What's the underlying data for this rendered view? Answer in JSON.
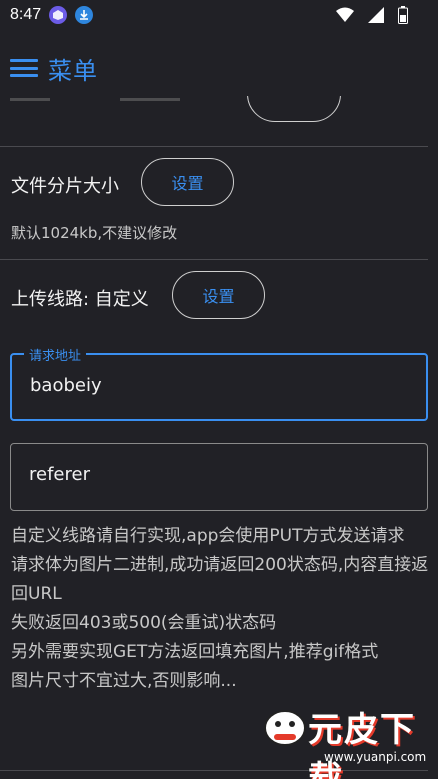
{
  "status_bar": {
    "time": "8:47",
    "icons": [
      "app-badge-icon",
      "download-icon",
      "wifi-icon",
      "signal-icon",
      "battery-icon"
    ]
  },
  "app_bar": {
    "title": "菜单",
    "menu_icon": "hamburger-menu-icon",
    "accent_color": "#3a8ff0"
  },
  "file_chunk": {
    "label": "文件分片大小",
    "button_label": "设置",
    "hint": "默认1024kb,不建议修改"
  },
  "upload_route": {
    "label": "上传线路: 自定义",
    "button_label": "设置"
  },
  "request_url_field": {
    "legend": "请求地址",
    "value": "baobeiy"
  },
  "referer_field": {
    "value": "referer"
  },
  "description": [
    "自定义线路请自行实现,app会使用PUT方式发送请求",
    "请求体为图片二进制,成功请返回200状态码,内容直接返回URL",
    "失败返回403或500(会重试)状态码",
    "另外需要实现GET方法返回填充图片,推荐gif格式",
    "图片尺寸不宜过大,否则影响..."
  ],
  "watermark": {
    "brand": "元皮下载",
    "url": "www.yuanpi.com"
  },
  "colors": {
    "background": "#212126",
    "accent": "#3a8ff0",
    "text": "#f2f2f2",
    "muted_text": "#c8c8c8"
  }
}
